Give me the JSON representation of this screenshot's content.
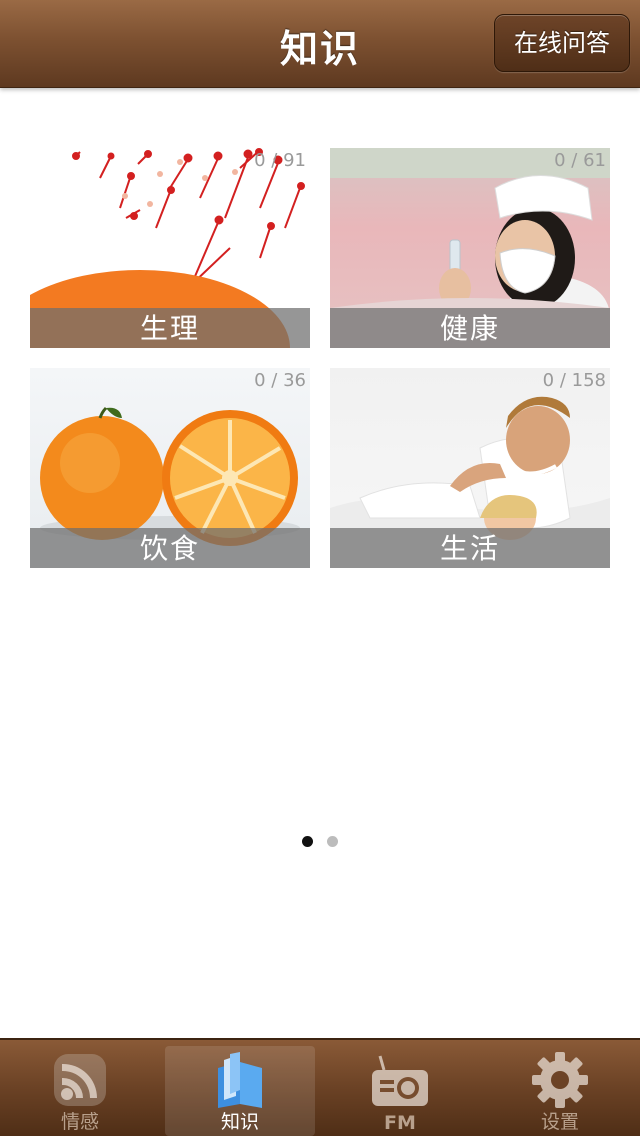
{
  "header": {
    "title": "知识",
    "qa_button_label": "在线问答"
  },
  "tiles": [
    {
      "label": "生理",
      "count": "0 / 91"
    },
    {
      "label": "健康",
      "count": "0 / 61"
    },
    {
      "label": "饮食",
      "count": "0 / 36"
    },
    {
      "label": "生活",
      "count": "0 / 158"
    }
  ],
  "pager": {
    "current": 1,
    "total": 2
  },
  "tabs": [
    {
      "label": "情感",
      "icon": "rss-icon",
      "selected": false
    },
    {
      "label": "知识",
      "icon": "books-icon",
      "selected": true
    },
    {
      "label": "FM",
      "icon": "radio-icon",
      "selected": false
    },
    {
      "label": "设置",
      "icon": "gear-icon",
      "selected": false
    }
  ],
  "colors": {
    "nav_brown": "#7d5131",
    "accent_orange": "#f57f20"
  }
}
